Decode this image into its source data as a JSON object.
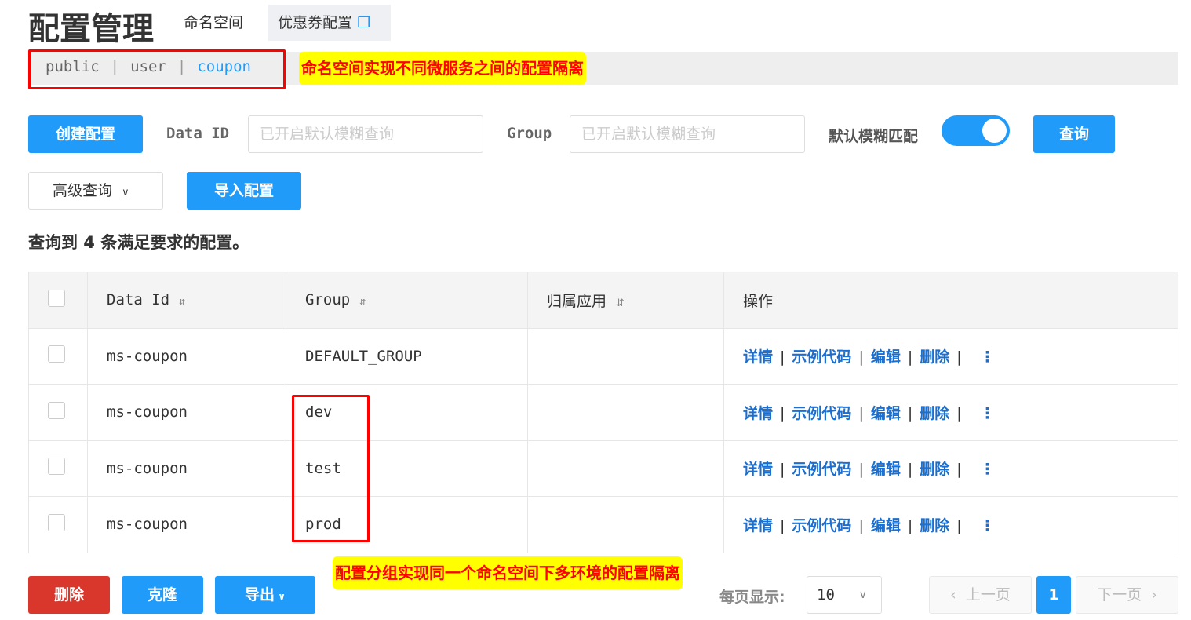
{
  "header": {
    "title": "配置管理",
    "tab_namespace": "命名空间",
    "tab_config": "优惠券配置"
  },
  "namespaces": [
    "public",
    "user",
    "coupon"
  ],
  "annotations": {
    "namespace": "命名空间实现不同微服务之间的配置隔离",
    "group": "配置分组实现同一个命名空间下多环境的配置隔离"
  },
  "toolbar": {
    "create": "创建配置",
    "data_id_label": "Data ID",
    "data_id_placeholder": "已开启默认模糊查询",
    "group_label": "Group",
    "group_placeholder": "已开启默认模糊查询",
    "fuzzy_label": "默认模糊匹配",
    "fuzzy_on": true,
    "query": "查询",
    "advanced": "高级查询",
    "import": "导入配置"
  },
  "result_text": "查询到 4 条满足要求的配置。",
  "table": {
    "headers": [
      "Data Id",
      "Group",
      "归属应用",
      "操作"
    ],
    "rows": [
      {
        "data_id": "ms-coupon",
        "group": "DEFAULT_GROUP",
        "app": ""
      },
      {
        "data_id": "ms-coupon",
        "group": "dev",
        "app": ""
      },
      {
        "data_id": "ms-coupon",
        "group": "test",
        "app": ""
      },
      {
        "data_id": "ms-coupon",
        "group": "prod",
        "app": ""
      }
    ],
    "actions": [
      "详情",
      "示例代码",
      "编辑",
      "删除"
    ]
  },
  "footer": {
    "delete": "删除",
    "clone": "克隆",
    "export": "导出",
    "page_size_label": "每页显示:",
    "page_size": "10",
    "prev": "上一页",
    "current_page": "1",
    "next": "下一页"
  }
}
